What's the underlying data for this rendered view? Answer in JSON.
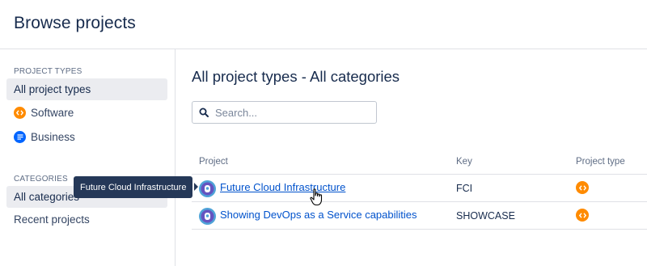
{
  "header": {
    "title": "Browse projects"
  },
  "sidebar": {
    "project_types_label": "PROJECT TYPES",
    "project_types": [
      {
        "label": "All project types",
        "icon": null,
        "selected": true
      },
      {
        "label": "Software",
        "icon": "software-icon",
        "selected": false
      },
      {
        "label": "Business",
        "icon": "business-icon",
        "selected": false
      }
    ],
    "categories_label": "CATEGORIES",
    "categories": [
      {
        "label": "All categories",
        "selected": true
      },
      {
        "label": "Recent projects",
        "selected": false
      }
    ]
  },
  "main": {
    "title": "All project types - All categories",
    "search": {
      "placeholder": "Search...",
      "value": ""
    }
  },
  "table": {
    "columns": [
      "Project",
      "Key",
      "Project type"
    ],
    "rows": [
      {
        "project": "Future Cloud Infrastructure",
        "key": "FCI",
        "type_icon": "software-icon",
        "hovered": true
      },
      {
        "project": "Showing DevOps as a Service capabilities",
        "key": "SHOWCASE",
        "type_icon": "software-icon",
        "hovered": false
      }
    ]
  },
  "tooltip": {
    "text": "Future Cloud Infrastructure"
  },
  "colors": {
    "accent": "#0052cc",
    "software": "#ff8b00",
    "business": "#0065ff",
    "selected_bg": "#ebecf0",
    "tooltip_bg": "#253858"
  }
}
